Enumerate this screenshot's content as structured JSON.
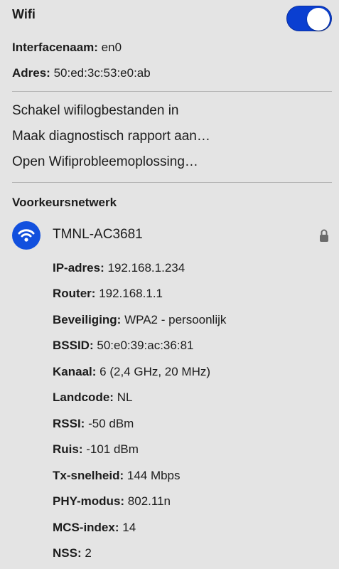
{
  "header": {
    "title": "Wifi",
    "enabled": true
  },
  "interface": {
    "name_label": "Interfacenaam:",
    "name_value": "en0",
    "address_label": "Adres:",
    "address_value": "50:ed:3c:53:e0:ab"
  },
  "menu": [
    {
      "label": "Schakel wifilogbestanden in"
    },
    {
      "label": "Maak diagnostisch rapport aan…"
    },
    {
      "label": "Open Wifiprobleemoplossing…"
    }
  ],
  "preferred": {
    "section_label": "Voorkeursnetwerk",
    "network_name": "TMNL-AC3681",
    "icon": "wifi-icon",
    "secured_icon": "lock-icon",
    "details": [
      {
        "label": "IP-adres:",
        "value": "192.168.1.234"
      },
      {
        "label": "Router:",
        "value": "192.168.1.1"
      },
      {
        "label": "Beveiliging:",
        "value": "WPA2 - persoonlijk"
      },
      {
        "label": "BSSID:",
        "value": "50:e0:39:ac:36:81"
      },
      {
        "label": "Kanaal:",
        "value": "6 (2,4 GHz, 20 MHz)"
      },
      {
        "label": "Landcode:",
        "value": "NL"
      },
      {
        "label": "RSSI:",
        "value": "-50 dBm"
      },
      {
        "label": "Ruis:",
        "value": "-101 dBm"
      },
      {
        "label": "Tx-snelheid:",
        "value": "144 Mbps"
      },
      {
        "label": "PHY-modus:",
        "value": "802.11n"
      },
      {
        "label": "MCS-index:",
        "value": "14"
      },
      {
        "label": "NSS:",
        "value": "2"
      }
    ]
  },
  "colors": {
    "toggle_on": "#0a3fd1",
    "wifi_badge": "#1250de",
    "background": "#e4e4e4",
    "divider": "#b2b2b2"
  }
}
